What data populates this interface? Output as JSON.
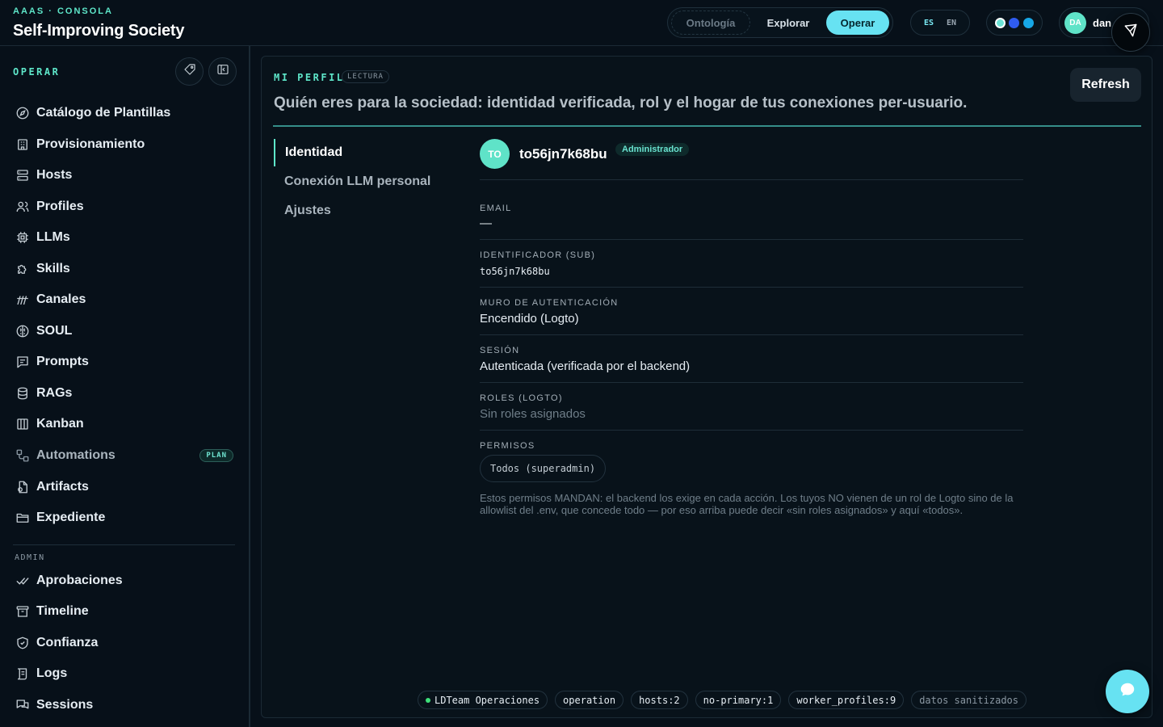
{
  "header": {
    "kicker": "AAAS · CONSOLA",
    "title": "Self-Improving Society",
    "modes": [
      "Ontología",
      "Explorar",
      "Operar"
    ],
    "active_mode": "Operar",
    "languages": [
      "ES",
      "EN"
    ],
    "active_language": "ES",
    "theme_colors": [
      "#6be3d6",
      "#2f5cf0",
      "#17a7e6"
    ],
    "user": {
      "initials": "DA",
      "name": "dan"
    }
  },
  "sidebar": {
    "title": "OPERAR",
    "items": [
      {
        "label": "Catálogo de Plantillas",
        "icon": "compass-icon"
      },
      {
        "label": "Provisionamiento",
        "icon": "building-icon"
      },
      {
        "label": "Hosts",
        "icon": "server-icon"
      },
      {
        "label": "Profiles",
        "icon": "users-icon"
      },
      {
        "label": "LLMs",
        "icon": "cpu-icon"
      },
      {
        "label": "Skills",
        "icon": "puzzle-icon"
      },
      {
        "label": "Canales",
        "icon": "signal-icon"
      },
      {
        "label": "SOUL",
        "icon": "brain-icon"
      },
      {
        "label": "Prompts",
        "icon": "message-square-icon"
      },
      {
        "label": "RAGs",
        "icon": "database-icon"
      },
      {
        "label": "Kanban",
        "icon": "columns-icon"
      },
      {
        "label": "Automations",
        "icon": "workflow-icon",
        "badge": "PLAN"
      },
      {
        "label": "Artifacts",
        "icon": "file-icon"
      },
      {
        "label": "Expediente",
        "icon": "folder-icon"
      }
    ],
    "admin_title": "ADMIN",
    "admin_items": [
      {
        "label": "Aprobaciones",
        "icon": "check-double-icon"
      },
      {
        "label": "Timeline",
        "icon": "archive-icon"
      },
      {
        "label": "Confianza",
        "icon": "shield-icon"
      },
      {
        "label": "Logs",
        "icon": "scroll-icon"
      },
      {
        "label": "Sessions",
        "icon": "chat-icon"
      }
    ]
  },
  "main": {
    "kicker": "MI PERFIL",
    "kicker_badge": "LECTURA",
    "subtitle": "Quién eres para la sociedad: identidad verificada, rol y el hogar de tus conexiones per-usuario.",
    "refresh_label": "Refresh",
    "tabs": [
      "Identidad",
      "Conexión LLM personal",
      "Ajustes"
    ],
    "active_tab": "Identidad",
    "profile": {
      "initials": "TO",
      "name": "to56jn7k68bu",
      "role_badge": "Administrador"
    },
    "fields": {
      "email_label": "EMAIL",
      "email_value": "—",
      "sub_label": "IDENTIFICADOR (SUB)",
      "sub_value": "to56jn7k68bu",
      "auth_label": "MURO DE AUTENTICACIÓN",
      "auth_value": "Encendido (Logto)",
      "session_label": "SESIÓN",
      "session_value": "Autenticada (verificada por el backend)",
      "roles_label": "ROLES (LOGTO)",
      "roles_value": "Sin roles asignados",
      "perms_label": "PERMISOS",
      "perms_value": "Todos (superadmin)",
      "perms_note": "Estos permisos MANDAN: el backend los exige en cada acción. Los tuyos NO vienen de un rol de Logto sino de la allowlist del .env, que concede todo — por eso arriba puede decir «sin roles asignados» y aquí «todos»."
    },
    "footer_tags": [
      "LDTeam Operaciones",
      "operation",
      "hosts:2",
      "no-primary:1",
      "worker_profiles:9",
      "datos sanitizados"
    ]
  }
}
